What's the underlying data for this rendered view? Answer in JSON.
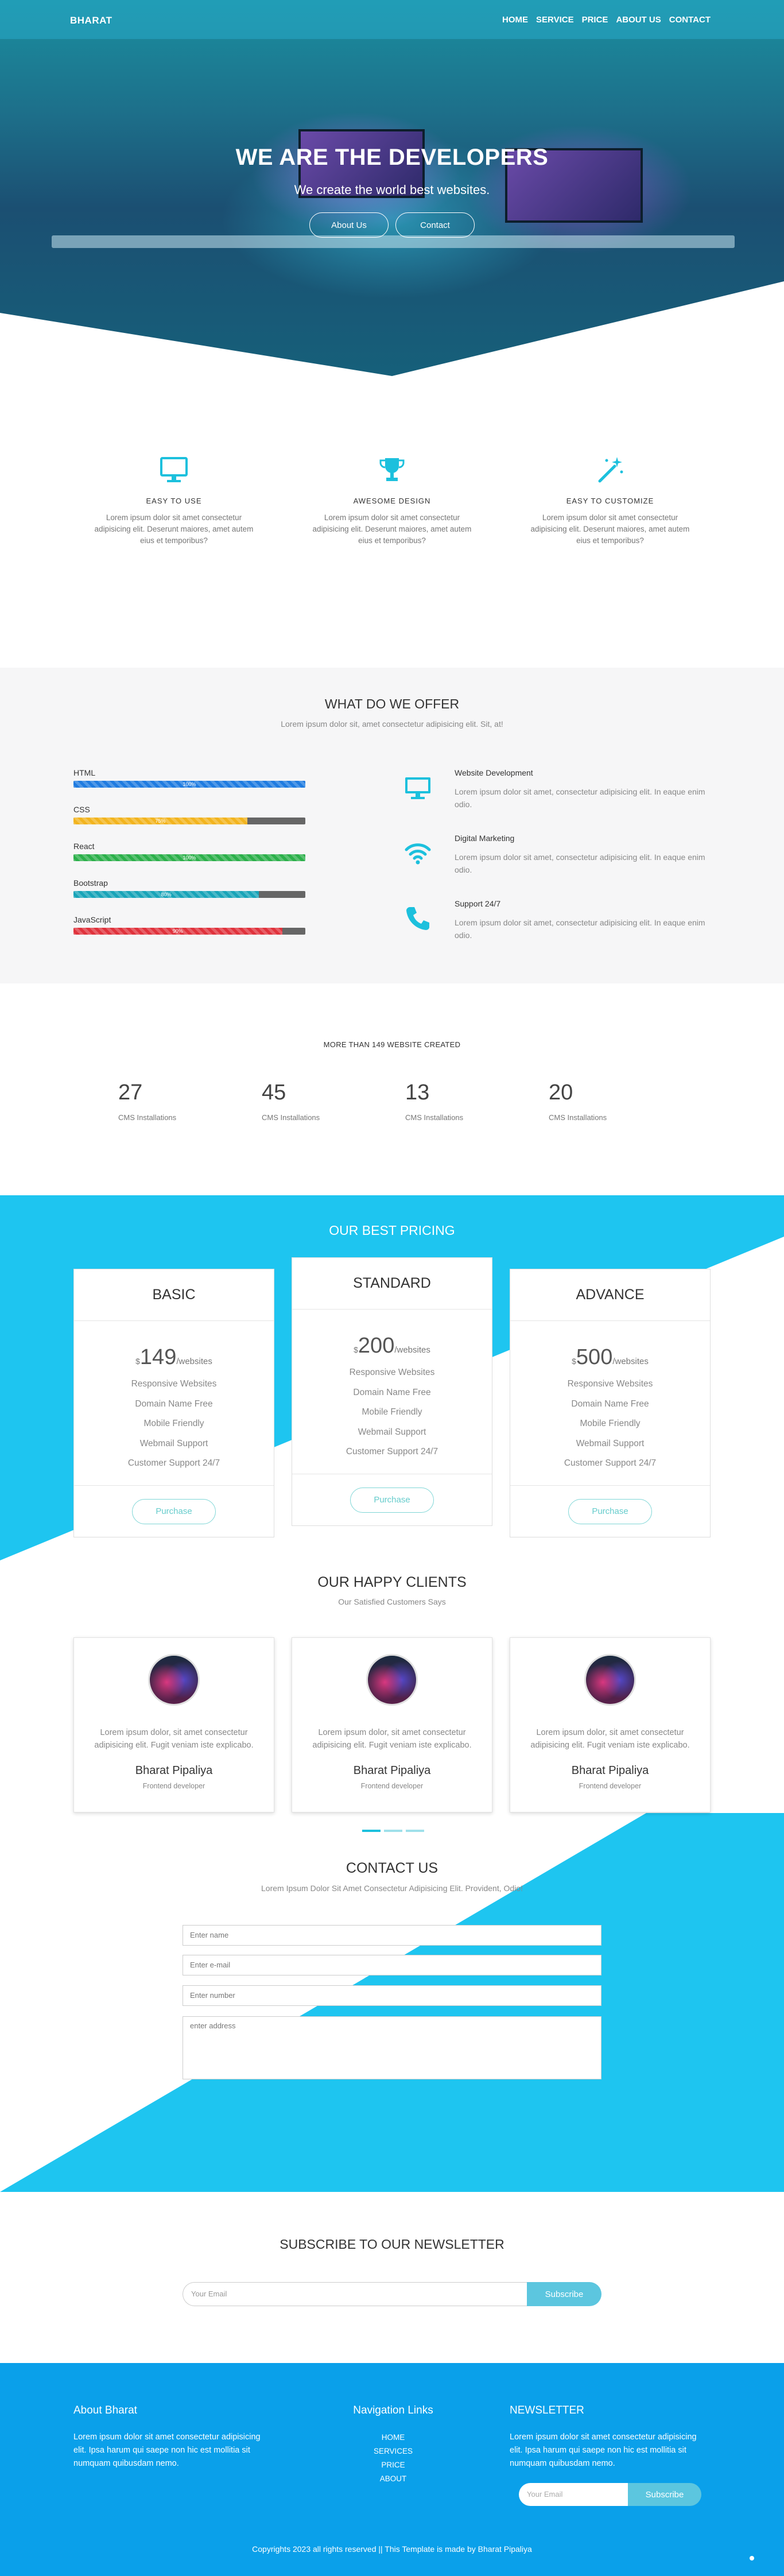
{
  "nav": {
    "brand": "BHARAT",
    "links": [
      "HOME",
      "SERVICE",
      "PRICE",
      "ABOUT US",
      "CONTACT"
    ]
  },
  "hero": {
    "title": "WE ARE THE DEVELOPERS",
    "subtitle": "We create the world best websites.",
    "buttons": [
      "About Us",
      "Contact"
    ]
  },
  "features": [
    {
      "icon": "monitor-icon",
      "title": "EASY  TO  USE",
      "text": "Lorem ipsum dolor sit amet consectetur adipisicing elit. Deserunt maiores, amet autem eius et temporibus?"
    },
    {
      "icon": "trophy-icon",
      "title": "AWESOME  DESIGN",
      "text": "Lorem ipsum dolor sit amet consectetur adipisicing elit. Deserunt maiores, amet autem eius et temporibus?"
    },
    {
      "icon": "magic-wand-icon",
      "title": "EASY  TO  CUSTOMIZE",
      "text": "Lorem ipsum dolor sit amet consectetur adipisicing elit. Deserunt maiores, amet autem eius et temporibus?"
    }
  ],
  "offer": {
    "title": "WHAT DO WE OFFER",
    "subtitle": "Lorem ipsum dolor sit, amet consectetur adipisicing elit. Sit, at!",
    "skills": [
      {
        "name": "HTML",
        "percent": 100,
        "label": "100%",
        "color": "#1e7be0"
      },
      {
        "name": "CSS",
        "percent": 75,
        "label": "75%",
        "color": "#f2b41e"
      },
      {
        "name": "React",
        "percent": 100,
        "label": "100%",
        "color": "#2bb04a"
      },
      {
        "name": "Bootstrap",
        "percent": 80,
        "label": "80%",
        "color": "#18a4b8"
      },
      {
        "name": "JavaScript",
        "percent": 90,
        "label": "90%",
        "color": "#e0323c"
      }
    ],
    "services": [
      {
        "icon": "desktop-icon",
        "title": "Website  Development",
        "text": "Lorem ipsum dolor sit amet, consectetur adipisicing elit. In eaque enim odio."
      },
      {
        "icon": "wifi-icon",
        "title": "Digital  Marketing",
        "text": "Lorem ipsum dolor sit amet, consectetur adipisicing elit. In eaque enim odio."
      },
      {
        "icon": "phone-icon",
        "title": "Support  24/7",
        "text": "Lorem ipsum dolor sit amet, consectetur adipisicing elit. In eaque enim odio."
      }
    ]
  },
  "stats": {
    "title": "MORE THAN 149 WEBSITE CREATED",
    "items": [
      {
        "num": "27",
        "label": "CMS Installations"
      },
      {
        "num": "45",
        "label": "CMS Installations"
      },
      {
        "num": "13",
        "label": "CMS Installations"
      },
      {
        "num": "20",
        "label": "CMS Installations"
      }
    ]
  },
  "pricing": {
    "title": "OUR BEST PRICING",
    "plans": [
      {
        "name": "BASIC",
        "currency": "$",
        "amount": "149",
        "unit": "/websites",
        "features": [
          "Responsive Websites",
          "Domain Name Free",
          "Mobile Friendly",
          "Webmail Support",
          "Customer Support 24/7"
        ],
        "button": "Purchase"
      },
      {
        "name": "STANDARD",
        "currency": "$",
        "amount": "200",
        "unit": "/websites",
        "features": [
          "Responsive Websites",
          "Domain Name Free",
          "Mobile Friendly",
          "Webmail Support",
          "Customer Support 24/7"
        ],
        "button": "Purchase"
      },
      {
        "name": "ADVANCE",
        "currency": "$",
        "amount": "500",
        "unit": "/websites",
        "features": [
          "Responsive Websites",
          "Domain Name Free",
          "Mobile Friendly",
          "Webmail Support",
          "Customer Support 24/7"
        ],
        "button": "Purchase"
      }
    ]
  },
  "clients": {
    "title": "OUR HAPPY CLIENTS",
    "subtitle": "Our Satisfied Customers Says",
    "items": [
      {
        "text": "Lorem ipsum dolor, sit amet consectetur adipisicing elit. Fugit veniam iste explicabo.",
        "name": "Bharat Pipaliya",
        "role": "Frontend developer"
      },
      {
        "text": "Lorem ipsum dolor, sit amet consectetur adipisicing elit. Fugit veniam iste explicabo.",
        "name": "Bharat Pipaliya",
        "role": "Frontend developer"
      },
      {
        "text": "Lorem ipsum dolor, sit amet consectetur adipisicing elit. Fugit veniam iste explicabo.",
        "name": "Bharat Pipaliya",
        "role": "Frontend developer"
      }
    ]
  },
  "contact": {
    "title": "CONTACT US",
    "subtitle": "Lorem Ipsum Dolor Sit Amet Consectetur Adipisicing Elit. Provident, Odio!",
    "name_placeholder": "Enter name",
    "email_placeholder": "Enter e-mail",
    "number_placeholder": "Enter number",
    "address_placeholder": "enter address"
  },
  "newsletter": {
    "title": "SUBSCRIBE TO OUR NEWSLETTER",
    "placeholder": "Your Email",
    "button": "Subscribe"
  },
  "footer": {
    "about_title": "About Bharat",
    "about_text": "Lorem ipsum dolor sit amet consectetur adipisicing elit. Ipsa harum qui saepe non hic est mollitia sit numquam quibusdam nemo.",
    "links_title": "Navigation Links",
    "links": [
      "HOME",
      "SERVICES",
      "PRICE",
      "ABOUT"
    ],
    "news_title": "NEWSLETTER",
    "news_text": "Lorem ipsum dolor sit amet consectetur adipisicing elit. Ipsa harum qui saepe non hic est mollitia sit numquam quibusdam nemo.",
    "news_placeholder": "Your Email",
    "news_button": "Subscribe",
    "copyright": "Copyrights 2023 all rights reserved || This Template is made by Bharat Pipaliya"
  },
  "colors": {
    "accent": "#1cc0dd",
    "pricing_bg": "#1ec5f0",
    "footer_bg": "#0aa0ea",
    "subscribe": "#5cc6df"
  }
}
